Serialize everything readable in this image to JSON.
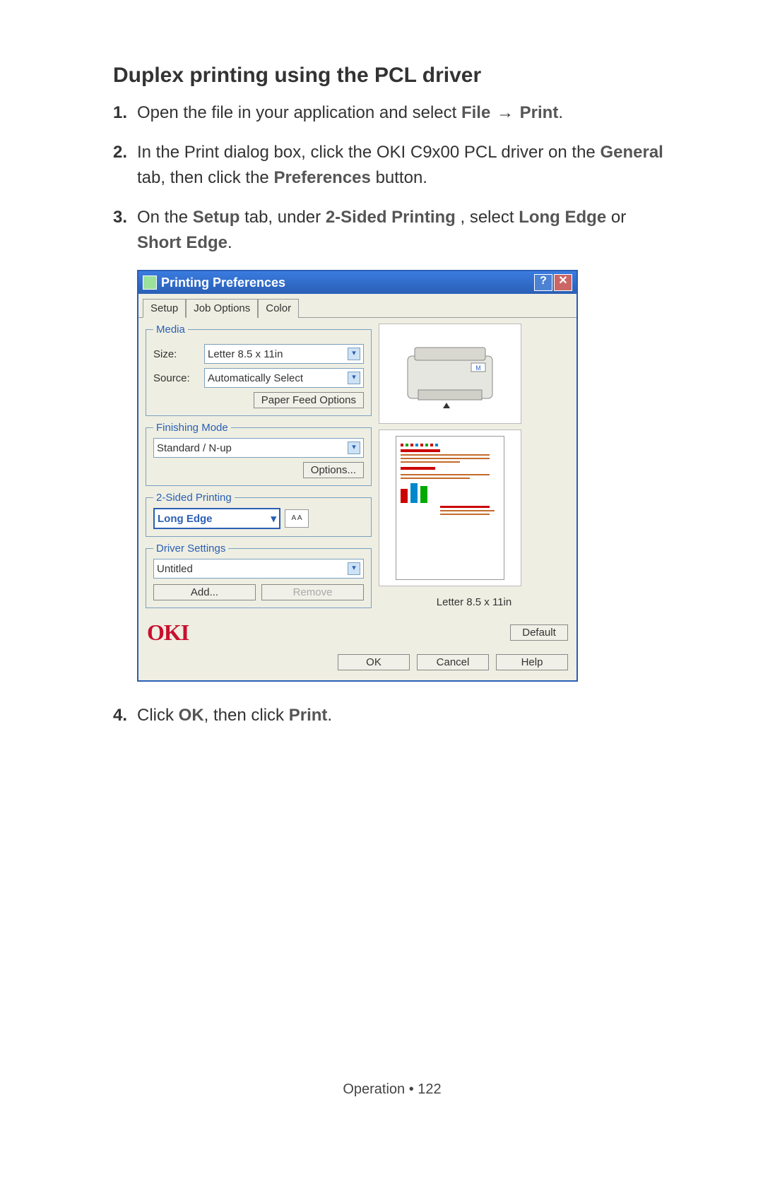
{
  "heading": "Duplex printing using the PCL driver",
  "steps": {
    "s1": {
      "num": "1.",
      "pre": "Open the file in your application and select ",
      "file": "File",
      "arrow": "→",
      "print": "Print",
      "post": "."
    },
    "s2": {
      "num": "2.",
      "pre": "In the Print dialog box, click the OKI C9x00 PCL driver on the ",
      "general": "General",
      "mid": " tab, then click the ",
      "prefs": "Preferences",
      "post": " button."
    },
    "s3": {
      "num": "3.",
      "pre": "On the ",
      "setup": "Setup",
      "mid1": " tab, under ",
      "twosided": "2-Sided Printing",
      "mid2": ", select ",
      "long": "Long Edge",
      "or": " or ",
      "short": "Short Edge",
      "post": "."
    },
    "s4": {
      "num": "4.",
      "pre": "Click ",
      "ok": "OK",
      "mid": ", then click ",
      "print": "Print",
      "post": "."
    }
  },
  "dialog": {
    "title": "Printing Preferences",
    "help_btn": "?",
    "close_btn": "✕",
    "tabs": {
      "setup": "Setup",
      "job": "Job Options",
      "color": "Color"
    },
    "media": {
      "legend": "Media",
      "size_label": "Size:",
      "size_value": "Letter 8.5 x 11in",
      "source_label": "Source:",
      "source_value": "Automatically Select",
      "paper_feed_btn": "Paper Feed Options"
    },
    "finishing": {
      "legend": "Finishing Mode",
      "value": "Standard / N-up",
      "options_btn": "Options..."
    },
    "duplex": {
      "legend": "2-Sided Printing",
      "value": "Long Edge",
      "icon_text": "A A"
    },
    "driver": {
      "legend": "Driver Settings",
      "value": "Untitled",
      "add_btn": "Add...",
      "remove_btn": "Remove"
    },
    "preview_label": "Letter 8.5 x 11in",
    "logo": "OKI",
    "default_btn": "Default",
    "ok_btn": "OK",
    "cancel_btn": "Cancel",
    "help_btn2": "Help"
  },
  "footer": {
    "section": "Operation",
    "sep": " • ",
    "page": "122"
  }
}
